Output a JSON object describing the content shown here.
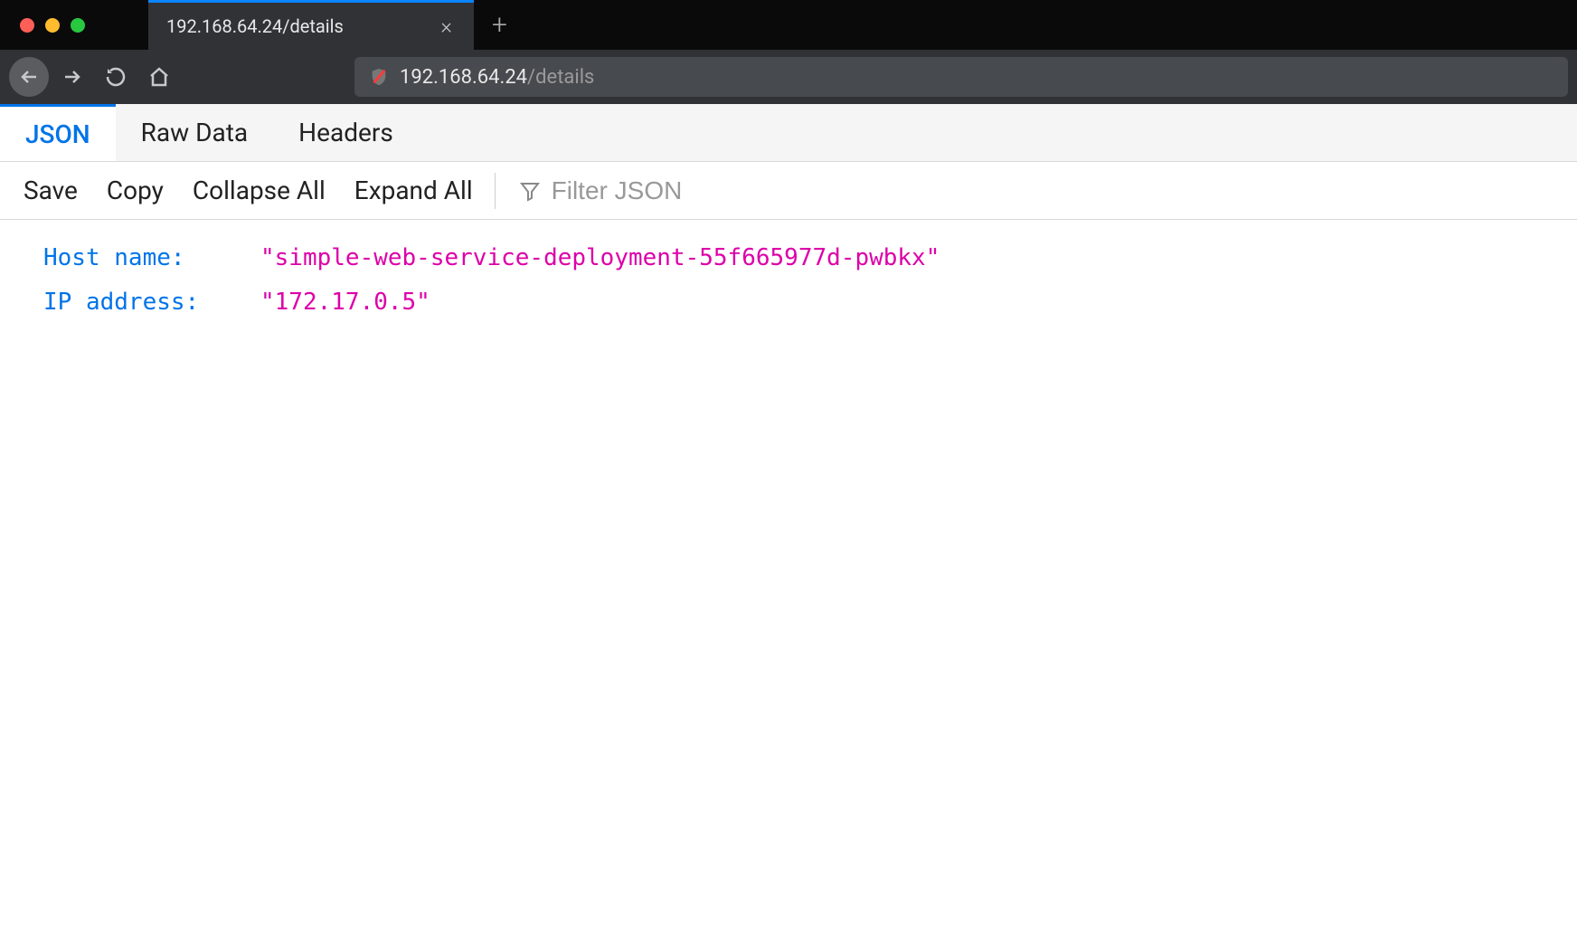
{
  "browser": {
    "tab_title": "192.168.64.24/details",
    "url_host": "192.168.64.24",
    "url_path": "/details"
  },
  "viewer": {
    "tabs": {
      "json": "JSON",
      "raw": "Raw Data",
      "headers": "Headers"
    },
    "actions": {
      "save": "Save",
      "copy": "Copy",
      "collapse_all": "Collapse All",
      "expand_all": "Expand All"
    },
    "filter_placeholder": "Filter JSON"
  },
  "json": {
    "rows": [
      {
        "key": "Host name:",
        "value": "\"simple-web-service-deployment-55f665977d-pwbkx\""
      },
      {
        "key": "IP address:",
        "value": "\"172.17.0.5\""
      }
    ]
  }
}
